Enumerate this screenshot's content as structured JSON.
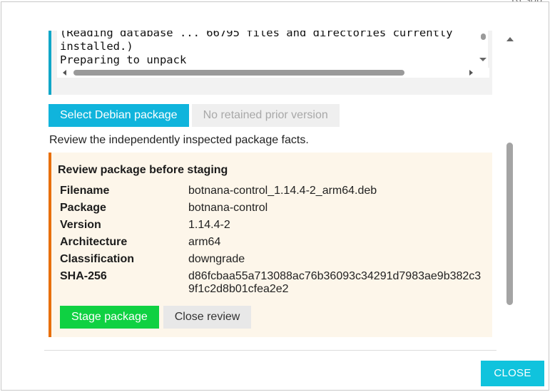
{
  "background": {
    "corner_text": "Resou"
  },
  "log": {
    "lines": [
      "(Reading database ... 66795 files and directories currently",
      "installed.)",
      "Preparing to unpack"
    ]
  },
  "actions": {
    "select_label": "Select Debian package",
    "prior_version_label": "No retained prior version"
  },
  "hint": "Review the independently inspected package facts.",
  "review": {
    "title": "Review package before staging",
    "facts": [
      {
        "key": "Filename",
        "value": "botnana-control_1.14.4-2_arm64.deb"
      },
      {
        "key": "Package",
        "value": "botnana-control"
      },
      {
        "key": "Version",
        "value": "1.14.4-2"
      },
      {
        "key": "Architecture",
        "value": "arm64"
      },
      {
        "key": "Classification",
        "value": "downgrade"
      },
      {
        "key": "SHA-256",
        "value": "d86fcbaa55a713088ac76b36093c34291d7983ae9b382c39f1c2d8b01cfea2e2"
      }
    ],
    "stage_label": "Stage package",
    "close_label": "Close review"
  },
  "footer": {
    "close_label": "CLOSE"
  },
  "colors": {
    "accent": "#10b4dc",
    "stage": "#0fd142",
    "review_border": "#e8700c",
    "review_bg": "#fdf6ea"
  }
}
